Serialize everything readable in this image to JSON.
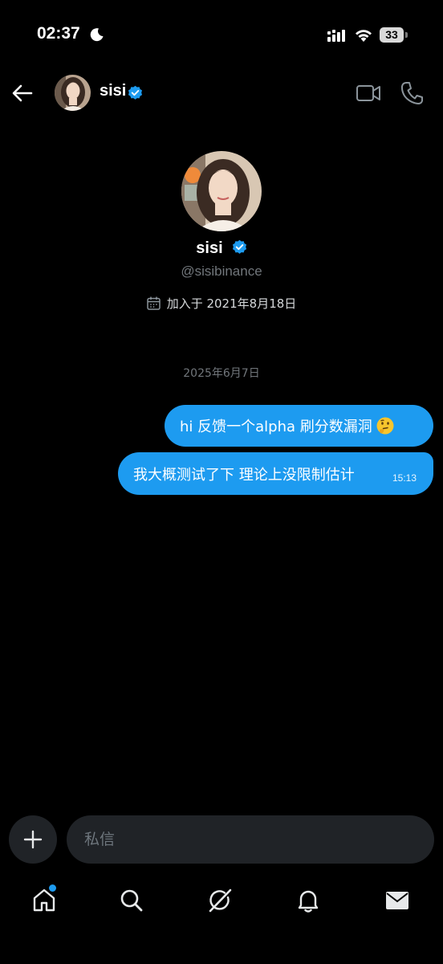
{
  "status_bar": {
    "time": "02:37",
    "battery": "33",
    "icons": [
      "moon-icon",
      "signal-icon",
      "wifi-icon",
      "battery-icon"
    ]
  },
  "header": {
    "name": "sisi",
    "icons": [
      "back-arrow-icon",
      "verified-badge-icon",
      "video-call-icon",
      "phone-call-icon"
    ]
  },
  "profile": {
    "name": "sisi",
    "handle": "@sisibinance",
    "joined": "加入于 2021年8月18日"
  },
  "conversation": {
    "date": "2025年6月7日",
    "messages": [
      {
        "text": "hi 反馈一个alpha 刷分数漏洞",
        "emoji": "thinking-face-icon",
        "time": ""
      },
      {
        "text": "我大概测试了下 理论上没限制估计",
        "time": "15:13"
      }
    ]
  },
  "composer": {
    "placeholder": "私信",
    "value": ""
  },
  "nav": {
    "items": [
      "home-icon",
      "search-icon",
      "grok-icon",
      "notifications-icon",
      "messages-icon"
    ]
  },
  "colors": {
    "accent": "#1d9bf0",
    "background": "#000000",
    "input_bg": "#202327",
    "muted_text": "#71767b"
  }
}
